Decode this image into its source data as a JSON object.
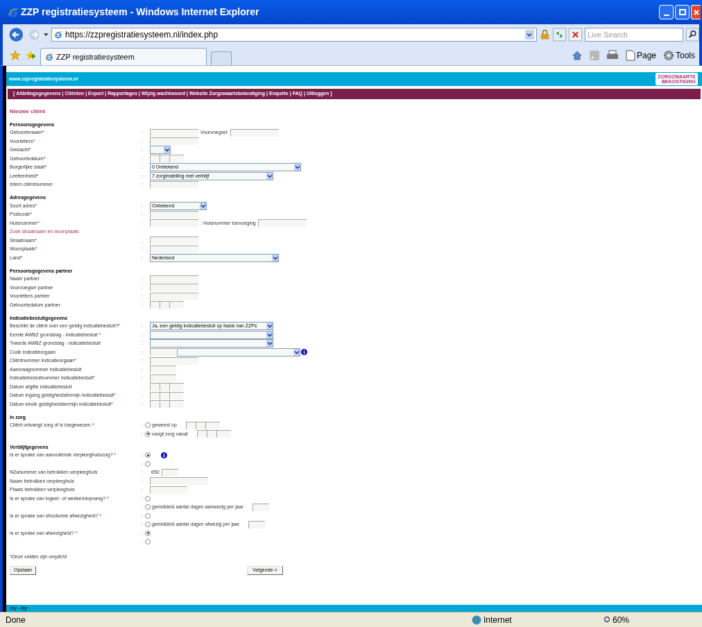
{
  "window": {
    "title": "ZZP registratiesysteem - Windows Internet Explorer"
  },
  "address_bar": {
    "url": "https://zzpregistratiesysteem.nl/index.php",
    "search_placeholder": "Live Search"
  },
  "tabs": [
    {
      "label": "ZZP registratiesysteem",
      "selected": true
    }
  ],
  "toolbar": {
    "page": "Page",
    "tools": "Tools"
  },
  "site": {
    "url": "www.zzpregistratiesysteem.nl",
    "logo_top": "ZORGZWAARTE",
    "logo_bottom": "BEKOSTIGING"
  },
  "nav": {
    "open": "[",
    "close": "]",
    "sep": "|",
    "items": [
      "Afdelingsgegevens",
      "Cliënten",
      "Export",
      "Rapportages",
      "Wijzig wachtwoord",
      "Website Zorgzwaartebekostiging",
      "Enquête",
      "FAQ",
      "Uitloggen"
    ]
  },
  "page_title": "Nieuwe cliënt",
  "sections": [
    {
      "title": "Persoonsgegevens",
      "rows": [
        {
          "kind": "fields",
          "label": "Geboortenaam",
          "mark": "*",
          "sep": ":",
          "controls": [
            {
              "kind": "input"
            },
            {
              "kind": "text",
              "text": "Voorvoegsel:"
            },
            {
              "kind": "input"
            }
          ]
        },
        {
          "kind": "fields",
          "label": "Voorletters",
          "mark": "*",
          "sep": ":",
          "controls": [
            {
              "kind": "input"
            }
          ]
        },
        {
          "kind": "fields",
          "label": "Geslacht",
          "mark": "*",
          "sep": ":",
          "controls": [
            {
              "kind": "select-xs"
            }
          ]
        },
        {
          "kind": "fields",
          "label": "Geboortedatum",
          "mark": "*",
          "sep": ":",
          "controls": [
            {
              "kind": "date"
            }
          ]
        },
        {
          "kind": "fields",
          "label": "Burgerlijke staat",
          "mark": "*",
          "sep": ":",
          "controls": [
            {
              "kind": "select-xl",
              "value": "0 Onbekend"
            }
          ]
        },
        {
          "kind": "fields",
          "label": "Leefeenheid",
          "mark": "*",
          "sep": ":",
          "controls": [
            {
              "kind": "select-m",
              "value": "7 zorginstelling met verblijf"
            }
          ]
        },
        {
          "kind": "fields",
          "label": "Intern cliëntnummer",
          "sep": ":",
          "controls": [
            {
              "kind": "input"
            }
          ]
        }
      ]
    },
    {
      "title": "Adresgegevens",
      "rows": [
        {
          "kind": "fields",
          "label": "Soort adres",
          "mark": "*",
          "sep": ":",
          "controls": [
            {
              "kind": "select-s",
              "value": "Onbekend"
            }
          ]
        },
        {
          "kind": "fields",
          "label": "Postcode",
          "mark": "*",
          "sep": ":",
          "controls": [
            {
              "kind": "input"
            }
          ]
        },
        {
          "kind": "fields",
          "label": "Huisnummer",
          "mark": "*",
          "sep": ":",
          "controls": [
            {
              "kind": "input"
            },
            {
              "kind": "text",
              "text": ": Huisnummer toevoeging"
            },
            {
              "kind": "input"
            }
          ]
        },
        {
          "kind": "link",
          "label": "Zoek straatnaam en woonplaats"
        },
        {
          "kind": "fields",
          "label": "Straatnaam",
          "mark": "*",
          "sep": ":",
          "controls": [
            {
              "kind": "input"
            }
          ]
        },
        {
          "kind": "fields",
          "label": "Woonplaats",
          "mark": "*",
          "sep": ":",
          "controls": [
            {
              "kind": "input"
            }
          ]
        },
        {
          "kind": "fields",
          "label": "Land",
          "mark": "*",
          "sep": ":",
          "controls": [
            {
              "kind": "select-l",
              "value": "Nederland"
            }
          ]
        }
      ]
    },
    {
      "title": "Persoonsgegevens partner",
      "rows": [
        {
          "kind": "fields",
          "label": "Naam partner",
          "sep": ":",
          "controls": [
            {
              "kind": "input"
            }
          ]
        },
        {
          "kind": "fields",
          "label": "Voorvoegsel partner",
          "sep": ":",
          "controls": [
            {
              "kind": "input"
            }
          ]
        },
        {
          "kind": "fields",
          "label": "Voorletters partner",
          "sep": ":",
          "controls": [
            {
              "kind": "input"
            }
          ]
        },
        {
          "kind": "fields",
          "label": "Geboortedatum partner",
          "sep": ":",
          "controls": [
            {
              "kind": "date"
            }
          ]
        }
      ]
    },
    {
      "title": "Indicatiebesluitgegevens",
      "rows": [
        {
          "kind": "fields",
          "label": "Beschikt de cliënt over een geldig indicatiebesluit?",
          "mark": "*",
          "sep": ":",
          "controls": [
            {
              "kind": "select-m",
              "value": "Ja, een geldig indicatiebesluit op basis van ZZPs"
            }
          ]
        },
        {
          "kind": "fields",
          "label": "Eerste AWBZ grondslag - indicatiebesluit ",
          "mark": "*",
          "sep": ":",
          "controls": [
            {
              "kind": "select-m"
            }
          ]
        },
        {
          "kind": "fields",
          "label": "Tweede AWBZ grondslag - indicatiebesluit",
          "sep": ":",
          "controls": [
            {
              "kind": "select-m"
            }
          ]
        },
        {
          "kind": "fields",
          "label": "Code indicatieorgaan",
          "sep": ":",
          "controls": [
            {
              "kind": "input-short"
            },
            {
              "kind": "select-m"
            },
            {
              "kind": "info"
            }
          ]
        },
        {
          "kind": "fields",
          "label": "Cliëntnummer indicatieorgaan",
          "mark": "*",
          "sep": ":",
          "controls": [
            {
              "kind": "input"
            }
          ]
        },
        {
          "kind": "fields",
          "label": "Aanvraagnummer indicatiebesluit",
          "sep": ":",
          "controls": [
            {
              "kind": "input-short"
            }
          ]
        },
        {
          "kind": "fields",
          "label": "Indicatiebesluitnummer indicatiebesluit",
          "mark": "*",
          "sep": ":",
          "controls": [
            {
              "kind": "input-short"
            }
          ]
        },
        {
          "kind": "fields",
          "label": "Datum afgifte indicatiebesluit",
          "sep": ":",
          "controls": [
            {
              "kind": "date"
            }
          ]
        },
        {
          "kind": "fields",
          "label": "Datum ingang geldigheidstermijn indicatiebesluit",
          "mark": "*",
          "sep": ":",
          "controls": [
            {
              "kind": "date"
            }
          ]
        },
        {
          "kind": "fields",
          "label": "Datum einde geldigheidstermijn indicatiebesluit",
          "mark": "*",
          "sep": ":",
          "controls": [
            {
              "kind": "date"
            }
          ]
        }
      ]
    },
    {
      "title": "In zorg",
      "rows": [
        {
          "kind": "radios",
          "label": "Cliënt ontvangt zorg of is toegewezen ",
          "mark": "*",
          "options": [
            {
              "kind": "radio-date",
              "sep": ":",
              "checked": false,
              "label": "geweest op"
            },
            {
              "kind": "radio-date",
              "sep": ":",
              "checked": true,
              "label": "vangt zorg vanaf"
            }
          ]
        }
      ]
    },
    {
      "title": "Verblijfgegevens",
      "rows": [
        {
          "kind": "radios",
          "label": "Is er sprake van aanvullende verpleeghuiszorg? ",
          "mark": "*",
          "options": [
            {
              "kind": "radio-info",
              "sep": ":",
              "checked": true
            },
            {
              "kind": "radio",
              "sep": ":",
              "checked": false
            }
          ]
        },
        {
          "kind": "fields",
          "label": "NZanummer van betrokken verpleeghuis",
          "sep": ":",
          "controls": [
            {
              "kind": "text",
              "text": "650"
            },
            {
              "kind": "input-xs"
            }
          ]
        },
        {
          "kind": "fields",
          "label": "Naam betrokken verpleeghuis",
          "sep": ":",
          "controls": [
            {
              "kind": "input-long"
            }
          ]
        },
        {
          "kind": "fields",
          "label": "Plaats betrokken verpleeghuis",
          "sep": ":",
          "controls": [
            {
              "kind": "input-short2"
            }
          ]
        },
        {
          "kind": "radios",
          "label": "Is er sprake van logeer- of weekendopvang? ",
          "mark": "*",
          "options": [
            {
              "kind": "radio",
              "sep": ":",
              "checked": false
            },
            {
              "kind": "radio-input",
              "sep": ":",
              "checked": false,
              "label": "gemiddeld aantal dagen aanwezig per jaar"
            }
          ]
        },
        {
          "kind": "radios",
          "label": "Is er sprake van structurele afwezigheid? ",
          "mark": "*",
          "options": [
            {
              "kind": "radio",
              "sep": ":",
              "checked": false
            },
            {
              "kind": "radio-input",
              "sep": ":",
              "checked": false,
              "label": "gemiddeld aantal dagen afwezig per jaar"
            }
          ]
        },
        {
          "kind": "radios",
          "label": "Is er sprake van afwezigheid? ",
          "mark": "*",
          "options": [
            {
              "kind": "radio",
              "sep": ":",
              "checked": true
            },
            {
              "kind": "radio",
              "sep": ":",
              "checked": false
            }
          ]
        }
      ]
    }
  ],
  "note": {
    "mark": "*",
    "text": "Deze velden zijn verplicht"
  },
  "buttons": {
    "save": "Opslaan",
    "next": "Volgende->"
  },
  "footer": "ley - ley",
  "status_bar": {
    "status": "Done",
    "zone": "Internet",
    "zoom": "60%"
  }
}
